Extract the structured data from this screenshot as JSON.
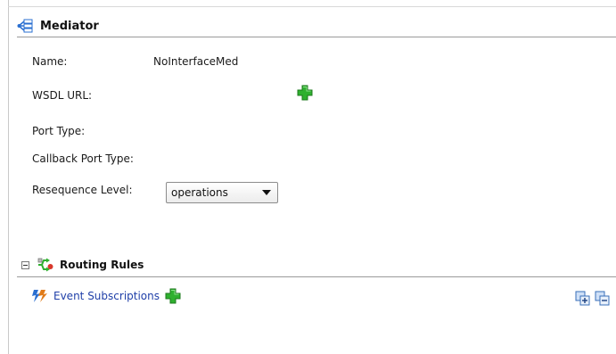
{
  "mediator": {
    "title": "Mediator",
    "icon": "mediator-icon",
    "fields": {
      "name_label": "Name:",
      "name_value": "NoInterfaceMed",
      "wsdl_label": "WSDL URL:",
      "port_type_label": "Port Type:",
      "callback_port_type_label": "Callback Port Type:",
      "resequence_label": "Resequence Level:",
      "resequence_value": "operations"
    },
    "add_wsdl_icon": "add-icon"
  },
  "routing_rules": {
    "title": "Routing Rules",
    "icon": "routing-rules-icon",
    "collapse_icon": "collapse-icon",
    "event_subscriptions_label": "Event Subscriptions",
    "event_icon": "lightning-icon",
    "add_icon": "add-icon",
    "expand_all_icon": "expand-all-icon",
    "collapse_all_icon": "collapse-all-icon"
  },
  "colors": {
    "add_green": "#2fb02f",
    "link_blue": "#1f3fa8",
    "event_orange": "#e07b1a"
  }
}
